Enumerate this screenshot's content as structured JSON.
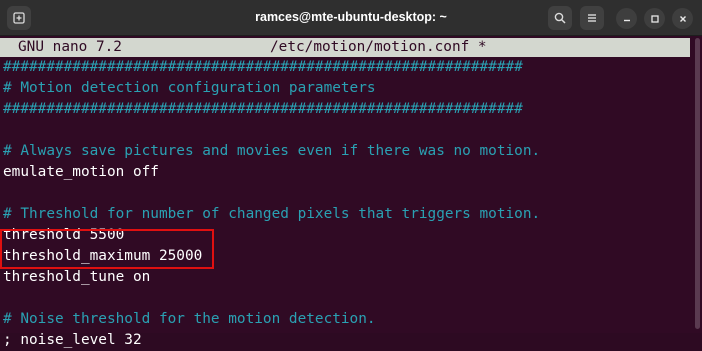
{
  "window": {
    "title": "ramces@mte-ubuntu-desktop: ~",
    "new_tab_icon": "new-tab-icon",
    "search_icon": "search-icon",
    "menu_icon": "hamburger-menu-icon",
    "minimize_icon": "minimize-icon",
    "maximize_icon": "maximize-icon",
    "close_icon": "close-icon"
  },
  "nano": {
    "version": "GNU nano 7.2",
    "filename": "/etc/motion/motion.conf *"
  },
  "file_lines": [
    {
      "type": "comment",
      "text": "############################################################"
    },
    {
      "type": "comment",
      "text": "# Motion detection configuration parameters"
    },
    {
      "type": "comment",
      "text": "############################################################"
    },
    {
      "type": "blank",
      "text": ""
    },
    {
      "type": "comment",
      "text": "# Always save pictures and movies even if there was no motion."
    },
    {
      "type": "code",
      "text": "emulate_motion off"
    },
    {
      "type": "blank",
      "text": ""
    },
    {
      "type": "comment",
      "text": "# Threshold for number of changed pixels that triggers motion."
    },
    {
      "type": "code",
      "text": "threshold 5500"
    },
    {
      "type": "code",
      "text": "threshold_maximum 25000"
    },
    {
      "type": "code",
      "text": "threshold_tune on"
    },
    {
      "type": "blank",
      "text": ""
    },
    {
      "type": "comment",
      "text": "# Noise threshold for the motion detection."
    },
    {
      "type": "code",
      "text": "; noise_level 32"
    }
  ],
  "colors": {
    "terminal_bg": "#300a24",
    "comment": "#2aa1b3",
    "text": "#ffffff",
    "highlight_box": "#e01010"
  }
}
